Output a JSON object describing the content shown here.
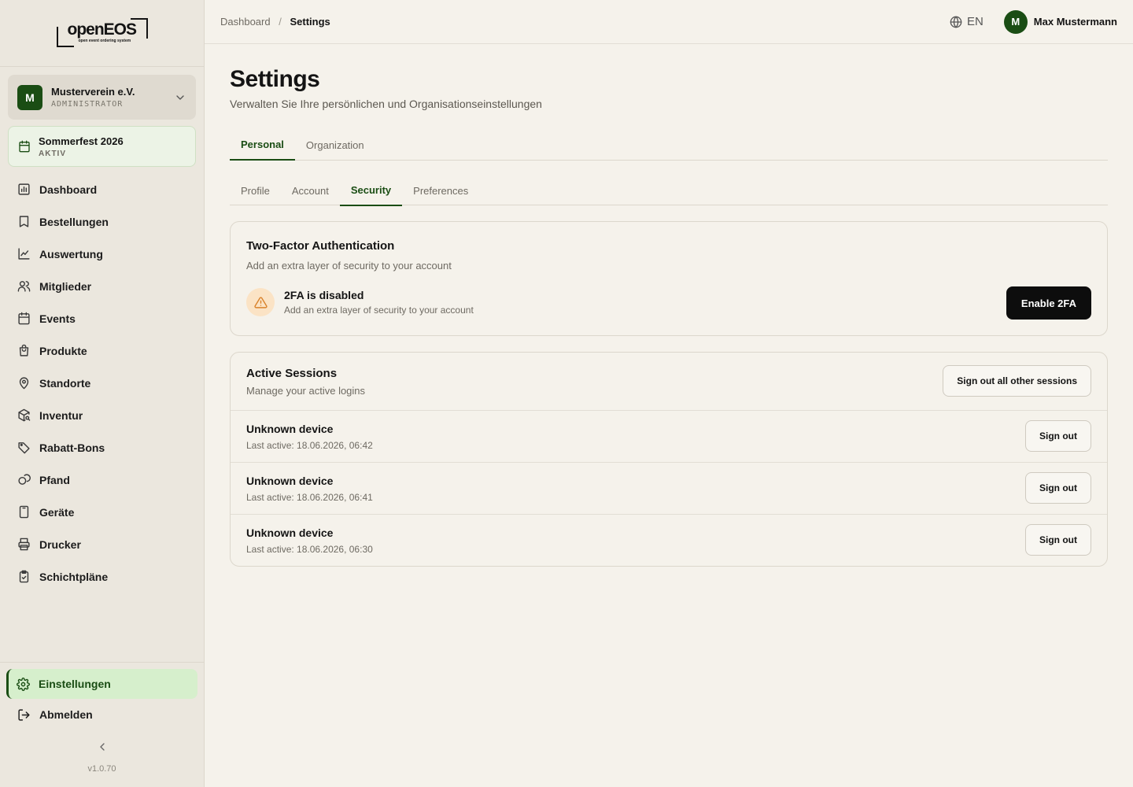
{
  "brand": {
    "name": "openEOS",
    "tagline": "open event ordering system"
  },
  "org": {
    "name": "Musterverein e.V.",
    "role": "ADMINISTRATOR",
    "initial": "M"
  },
  "event": {
    "name": "Sommerfest 2026",
    "status": "AKTIV"
  },
  "nav": [
    {
      "label": "Dashboard",
      "icon": "chart-icon"
    },
    {
      "label": "Bestellungen",
      "icon": "receipt-icon"
    },
    {
      "label": "Auswertung",
      "icon": "line-chart-icon"
    },
    {
      "label": "Mitglieder",
      "icon": "users-icon"
    },
    {
      "label": "Events",
      "icon": "calendar-icon"
    },
    {
      "label": "Produkte",
      "icon": "shopping-bag-icon"
    },
    {
      "label": "Standorte",
      "icon": "map-pin-icon"
    },
    {
      "label": "Inventur",
      "icon": "package-search-icon"
    },
    {
      "label": "Rabatt-Bons",
      "icon": "tag-icon"
    },
    {
      "label": "Pfand",
      "icon": "coins-icon"
    },
    {
      "label": "Geräte",
      "icon": "tablet-icon"
    },
    {
      "label": "Drucker",
      "icon": "printer-icon"
    },
    {
      "label": "Schichtpläne",
      "icon": "clipboard-check-icon"
    }
  ],
  "bottom_nav": {
    "settings": "Einstellungen",
    "logout": "Abmelden"
  },
  "version": "v1.0.70",
  "breadcrumb": {
    "parent": "Dashboard",
    "separator": "/",
    "current": "Settings"
  },
  "header": {
    "language": "EN",
    "user_name": "Max Mustermann",
    "user_initial": "M"
  },
  "page": {
    "title": "Settings",
    "subtitle": "Verwalten Sie Ihre persönlichen und Organisationseinstellungen"
  },
  "main_tabs": [
    {
      "label": "Personal",
      "active": true
    },
    {
      "label": "Organization",
      "active": false
    }
  ],
  "sub_tabs": [
    {
      "label": "Profile",
      "active": false
    },
    {
      "label": "Account",
      "active": false
    },
    {
      "label": "Security",
      "active": true
    },
    {
      "label": "Preferences",
      "active": false
    }
  ],
  "two_factor": {
    "title": "Two-Factor Authentication",
    "subtitle": "Add an extra layer of security to your account",
    "status_title": "2FA is disabled",
    "status_subtitle": "Add an extra layer of security to your account",
    "button": "Enable 2FA"
  },
  "sessions": {
    "title": "Active Sessions",
    "subtitle": "Manage your active logins",
    "sign_out_all": "Sign out all other sessions",
    "items": [
      {
        "device": "Unknown device",
        "last_active": "Last active: 18.06.2026, 06:42",
        "button": "Sign out"
      },
      {
        "device": "Unknown device",
        "last_active": "Last active: 18.06.2026, 06:41",
        "button": "Sign out"
      },
      {
        "device": "Unknown device",
        "last_active": "Last active: 18.06.2026, 06:30",
        "button": "Sign out"
      }
    ]
  },
  "colors": {
    "primary": "#1a4d14",
    "background": "#f5f2eb",
    "sidebar": "#ebe7de",
    "warning": "#d9822b"
  }
}
